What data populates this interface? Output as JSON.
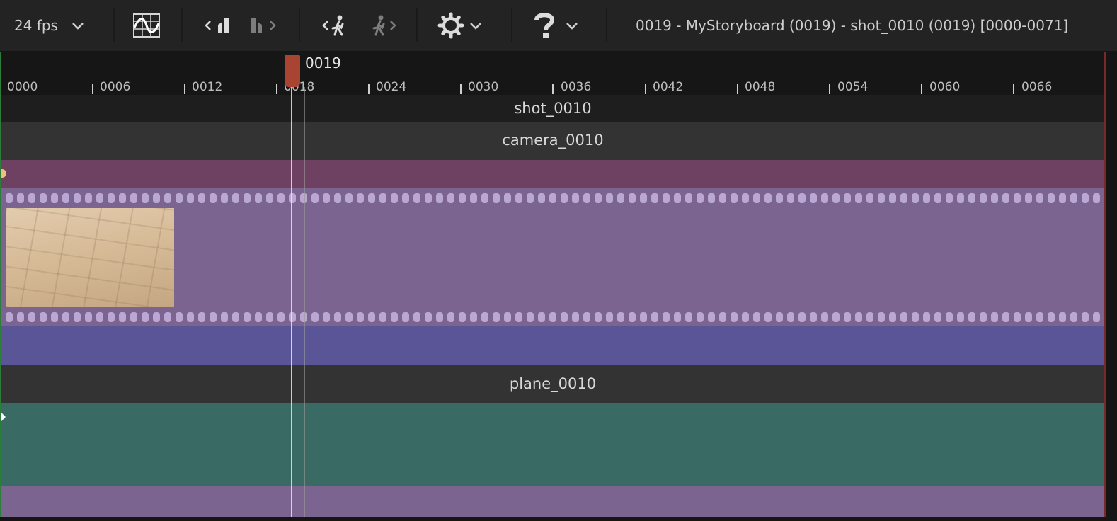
{
  "toolbar": {
    "fps_label": "24 fps",
    "title": "0019 - MyStoryboard (0019) - shot_0010 (0019) [0000-0071]",
    "icons": [
      "chevron-down-icon",
      "curve-editor-icon",
      "prev-key-icon",
      "next-key-icon",
      "prev-shot-icon",
      "next-shot-icon",
      "gear-icon",
      "help-icon"
    ]
  },
  "ruler": {
    "current_frame": "0019",
    "ticks": [
      "0000",
      "0006",
      "0012",
      "0018",
      "0024",
      "0030",
      "0036",
      "0042",
      "0048",
      "0054",
      "0060",
      "0066"
    ]
  },
  "tracks": {
    "shot": "shot_0010",
    "camera": "camera_0010",
    "plane": "plane_0010"
  },
  "colors": {
    "camera_key_band": "#6e4163",
    "film_strip": "#7b6490",
    "blue_band": "#5a5597",
    "plane_band": "#3a6a64",
    "bottom_band": "#7b6490",
    "playhead": "#a84431"
  }
}
